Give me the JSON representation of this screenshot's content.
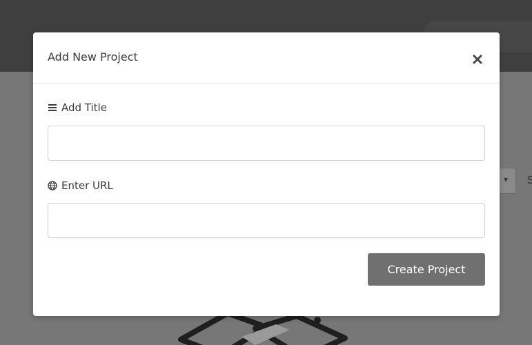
{
  "modal": {
    "title": "Add New Project",
    "close_icon": "close-icon",
    "fields": [
      {
        "label": "Add Title",
        "icon": "list-icon",
        "value": "",
        "placeholder": ""
      },
      {
        "label": "Enter URL",
        "icon": "globe-icon",
        "value": "",
        "placeholder": ""
      }
    ],
    "submit_label": "Create Project"
  },
  "background": {
    "peek_text": "S",
    "select_caret_icon": "caret-down-icon"
  },
  "colors": {
    "overlay_dark": "#3f3f3f",
    "overlay_body": "#777777",
    "button": "#707070",
    "modal_bg": "#ffffff"
  }
}
